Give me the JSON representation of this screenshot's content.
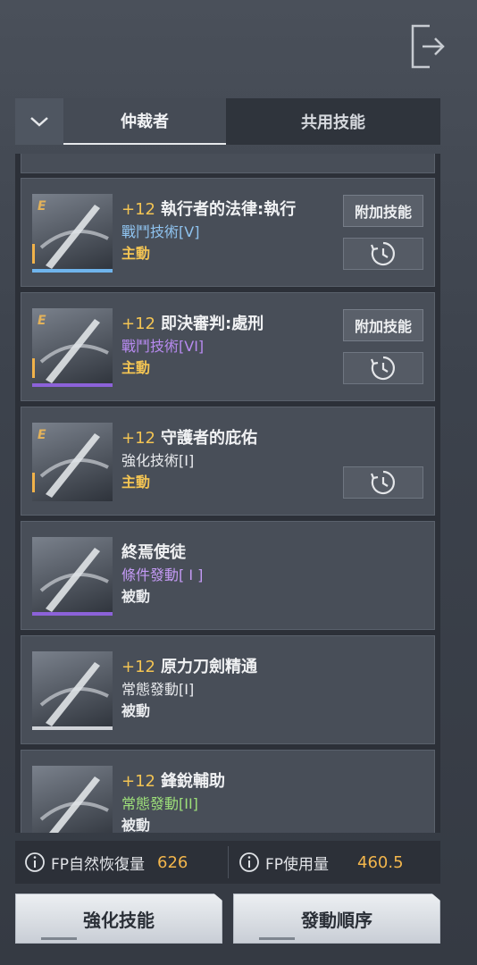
{
  "tabs": {
    "active": "仲裁者",
    "other": "共用技能"
  },
  "skills": [
    {
      "level": "+12",
      "name": "執行者的法律:執行",
      "category": "戰鬥技術[V]",
      "category_color": "#8fc3ef",
      "type": "主動",
      "type_color": "#f3c453",
      "tier": "E",
      "addon_label": "附加技能",
      "has_addon": true,
      "strip_color": "#6fb4ec"
    },
    {
      "level": "+12",
      "name": "即決審判:處刑",
      "category": "戰鬥技術[VI]",
      "category_color": "#b78af0",
      "type": "主動",
      "type_color": "#f3c453",
      "tier": "E",
      "addon_label": "附加技能",
      "has_addon": true,
      "strip_color": "#8c62d9"
    },
    {
      "level": "+12",
      "name": "守護者的庇佑",
      "category": "強化技術[I]",
      "category_color": "#e9ebee",
      "type": "主動",
      "type_color": "#f3c453",
      "tier": "E",
      "has_addon": false,
      "strip_color": ""
    },
    {
      "level": "",
      "name": "終焉使徒",
      "category": "條件發動[ I ]",
      "category_color": "#c49af5",
      "type": "被動",
      "type_color": "#e9ebee",
      "tier": "",
      "has_addon": false,
      "strip_color": "#8c62d9"
    },
    {
      "level": "+12",
      "name": "原力刀劍精通",
      "category": "常態發動[I]",
      "category_color": "#e9ebee",
      "type": "被動",
      "type_color": "#e9ebee",
      "tier": "",
      "has_addon": false,
      "strip_color": "#d0d3d8"
    },
    {
      "level": "+12",
      "name": "鋒銳輔助",
      "category": "常態發動[II]",
      "category_color": "#9ee07a",
      "type": "被動",
      "type_color": "#e9ebee",
      "tier": "",
      "has_addon": false,
      "strip_color": "#7fd45c"
    }
  ],
  "footer": {
    "fp_recovery_label": "FP自然恢復量",
    "fp_recovery_value": "626",
    "fp_usage_label": "FP使用量",
    "fp_usage_value": "460.5"
  },
  "buttons": {
    "enhance": "強化技能",
    "order": "發動順序"
  }
}
